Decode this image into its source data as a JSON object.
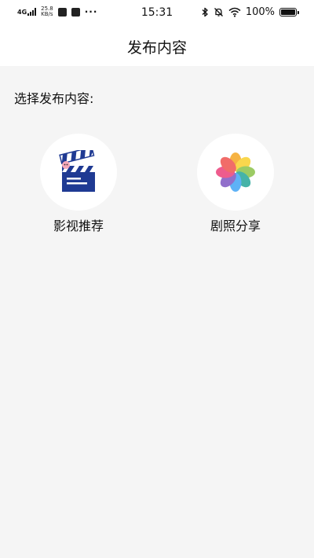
{
  "status_bar": {
    "network": "4G",
    "speed_value": "25.8",
    "speed_unit": "KB/s",
    "more": "···",
    "time": "15:31",
    "battery_percent": "100%"
  },
  "header": {
    "title": "发布内容"
  },
  "main": {
    "section_label": "选择发布内容:",
    "options": [
      {
        "label": "影视推荐",
        "icon": "film-clapperboard-icon"
      },
      {
        "label": "剧照分享",
        "icon": "photos-flower-icon"
      }
    ]
  },
  "colors": {
    "background": "#f5f5f5",
    "surface": "#ffffff",
    "clapper_blue": "#1f3a93"
  }
}
